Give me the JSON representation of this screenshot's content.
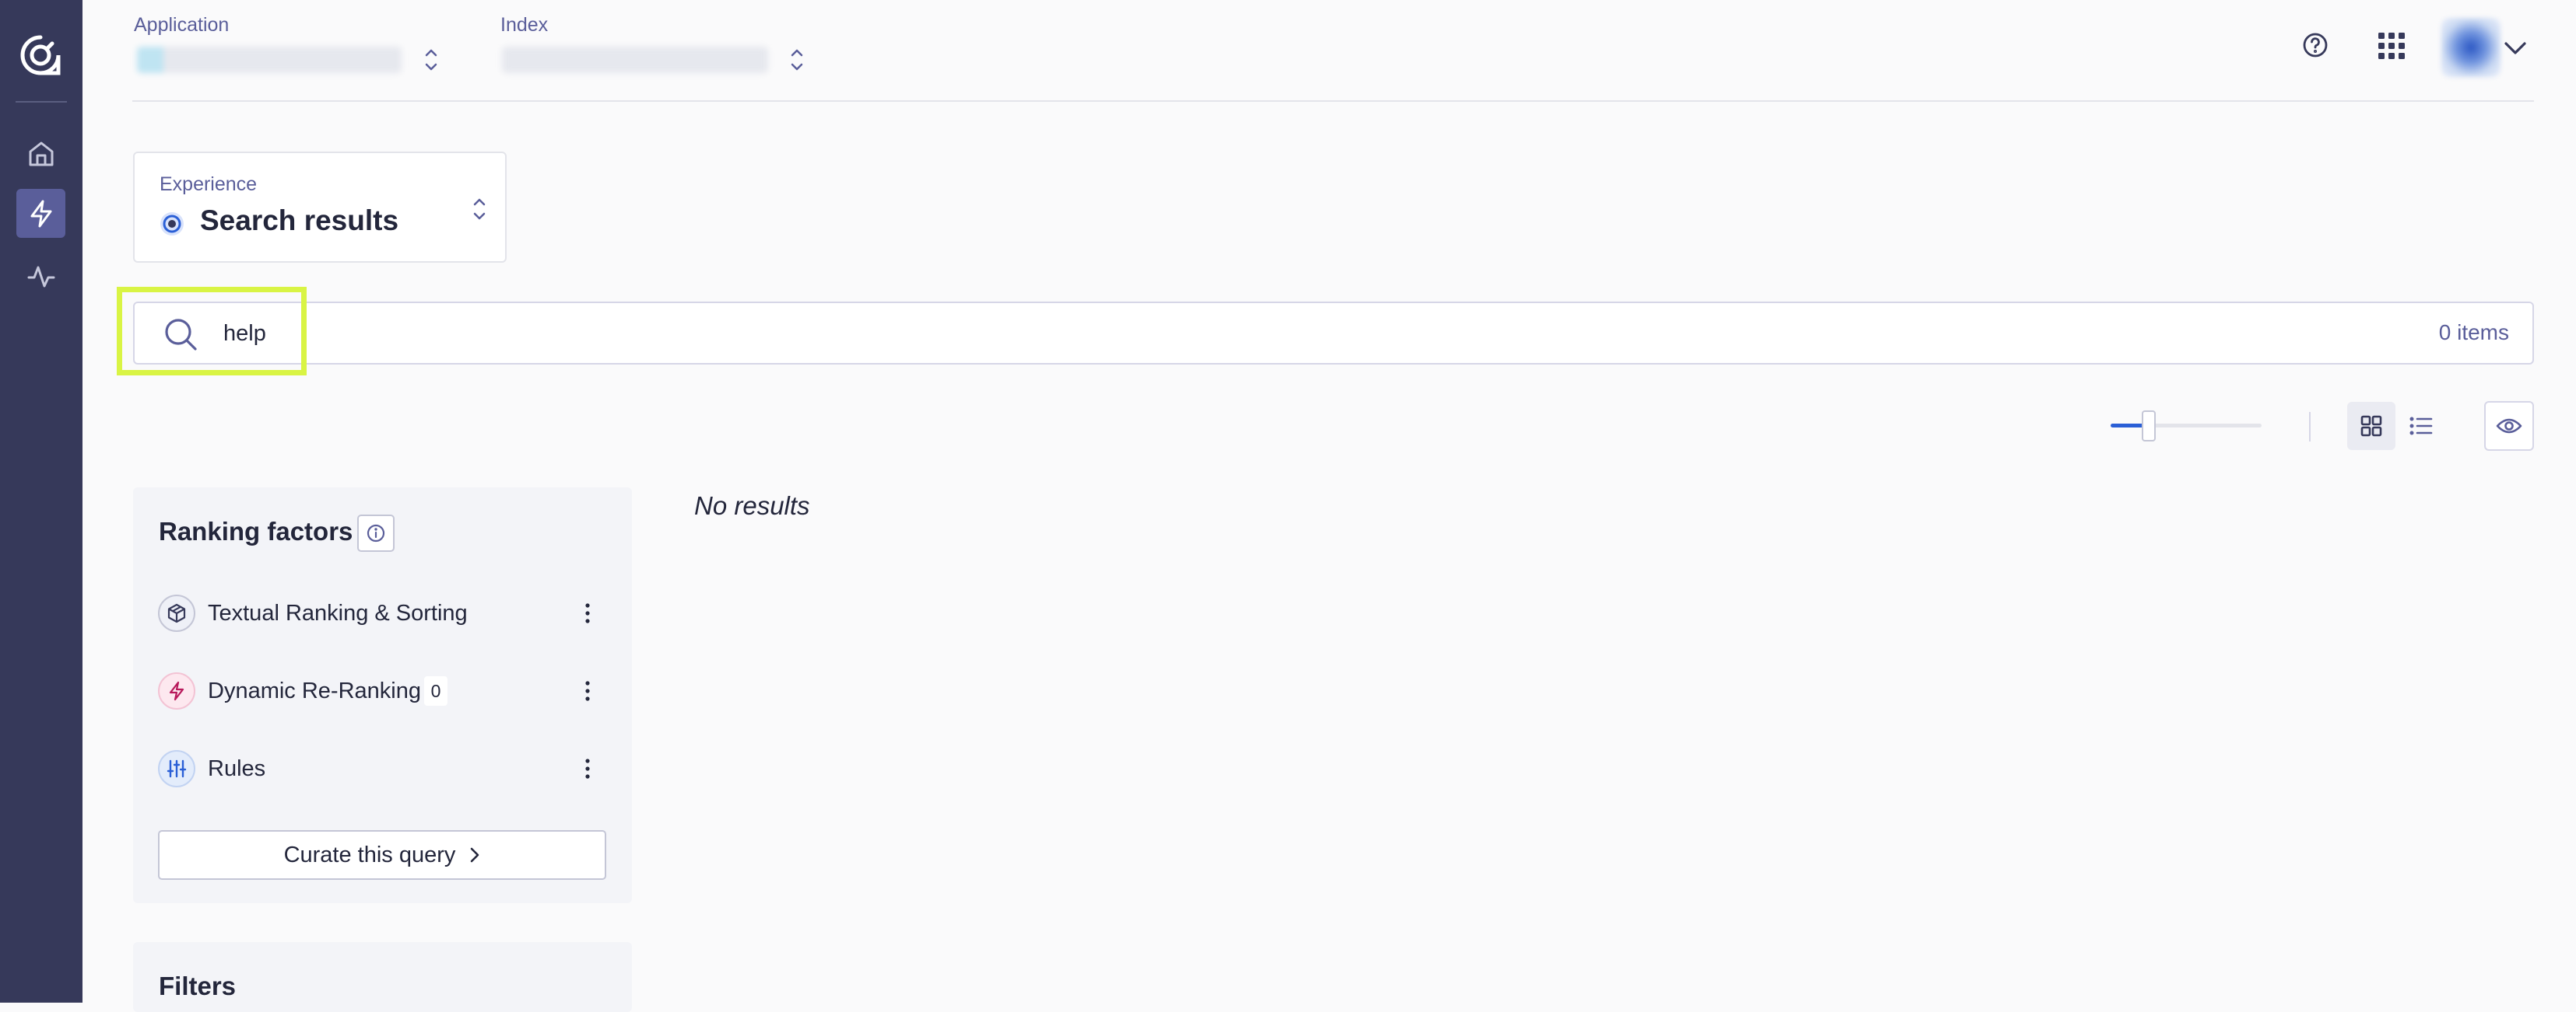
{
  "header": {
    "application_label": "Application",
    "index_label": "Index"
  },
  "experience": {
    "label": "Experience",
    "value": "Search results"
  },
  "search": {
    "value": "help",
    "items_count": "0 items"
  },
  "toolbar": {
    "hits_per_page_level": 0.25,
    "view_mode": "grid"
  },
  "ranking_factors": {
    "title": "Ranking factors",
    "items": [
      {
        "label": "Textual Ranking & Sorting",
        "icon": "textual-ranking-icon"
      },
      {
        "label": "Dynamic Re-Ranking",
        "icon": "dynamic-reranking-icon",
        "badge": "0"
      },
      {
        "label": "Rules",
        "icon": "rules-sliders-icon"
      }
    ],
    "curate_label": "Curate this query"
  },
  "filters": {
    "title": "Filters"
  },
  "results": {
    "empty_text": "No results"
  },
  "colors": {
    "sidebar": "#36395a",
    "sidebar_active": "#5a5e9a",
    "accent": "#2a5fd6",
    "highlight": "#d9f444",
    "text": "#23263b",
    "muted": "#5a5e9a"
  }
}
